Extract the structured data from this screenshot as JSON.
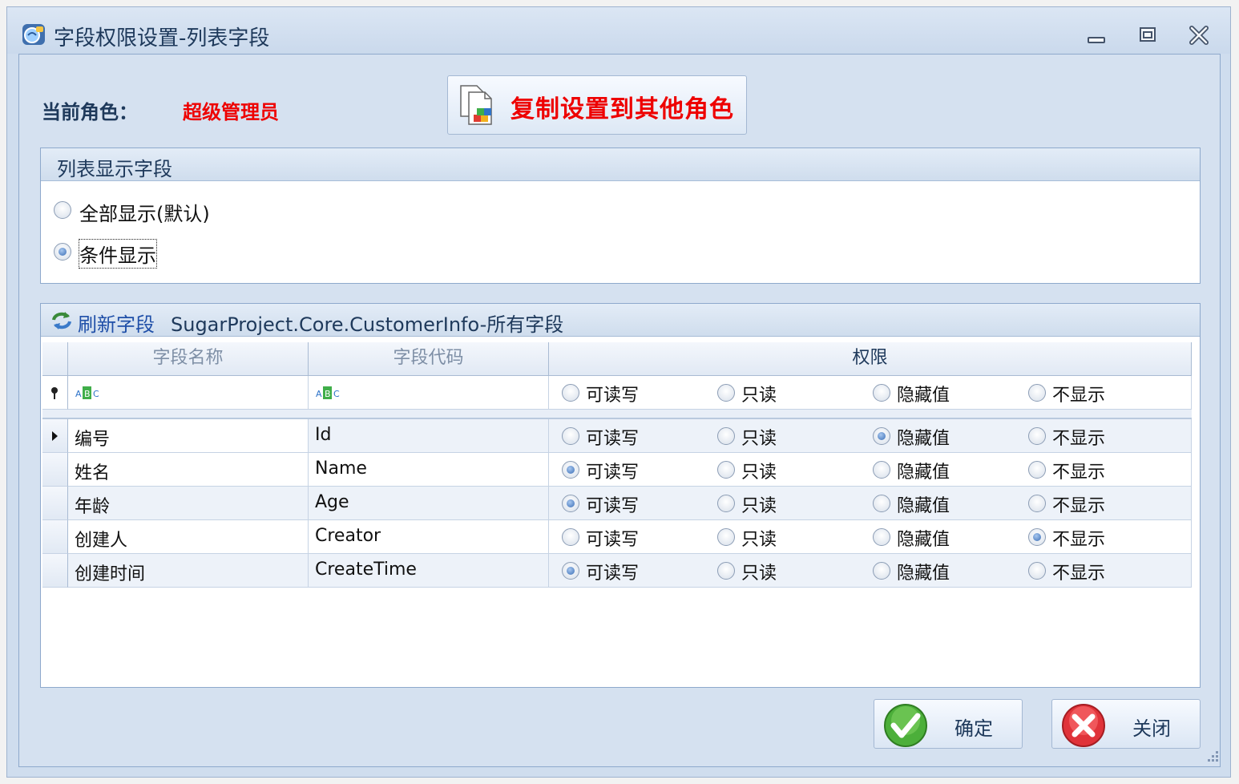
{
  "window": {
    "title": "字段权限设置-列表字段"
  },
  "role": {
    "label": "当前角色：",
    "value": "超级管理员"
  },
  "copy_button": {
    "label": "复制设置到其他角色"
  },
  "display_group": {
    "title": "列表显示字段",
    "options": [
      {
        "label": "全部显示(默认)",
        "checked": false
      },
      {
        "label": "条件显示",
        "checked": true
      }
    ]
  },
  "fields_group": {
    "refresh_label": "刷新字段",
    "entity_label": "SugarProject.Core.CustomerInfo-所有字段"
  },
  "grid": {
    "columns": {
      "name": "字段名称",
      "code": "字段代码",
      "permission": "权限"
    },
    "permission_options": [
      "可读写",
      "只读",
      "隐藏值",
      "不显示"
    ],
    "rows": [
      {
        "name": "编号",
        "code": "Id",
        "selected": 2
      },
      {
        "name": "姓名",
        "code": "Name",
        "selected": 0
      },
      {
        "name": "年龄",
        "code": "Age",
        "selected": 0
      },
      {
        "name": "创建人",
        "code": "Creator",
        "selected": 3
      },
      {
        "name": "创建时间",
        "code": "CreateTime",
        "selected": 0
      }
    ]
  },
  "buttons": {
    "ok": "确定",
    "close": "关闭"
  }
}
